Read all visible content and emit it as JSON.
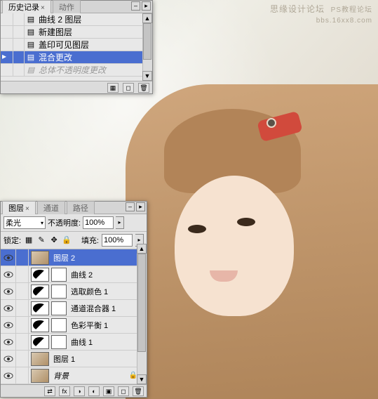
{
  "watermark": {
    "line1": "思缘设计论坛",
    "line2": "PS教程论坛",
    "line3": "bbs.16xx8.com"
  },
  "history_panel": {
    "tabs": {
      "history": "历史记录",
      "actions": "动作"
    },
    "items": [
      {
        "icon": "curves-icon",
        "label": "曲线 2 图层"
      },
      {
        "icon": "new-layer-icon",
        "label": "新建图层"
      },
      {
        "icon": "stamp-icon",
        "label": "盖印可见图层"
      },
      {
        "icon": "blend-icon",
        "label": "混合更改",
        "selected": true
      },
      {
        "icon": "opacity-icon",
        "label": "总体不透明度更改",
        "disabled": true
      }
    ]
  },
  "layers_panel": {
    "tabs": {
      "layers": "图层",
      "channels": "通道",
      "paths": "路径"
    },
    "blend_label": "柔光",
    "opacity_label": "不透明度:",
    "opacity_value": "100%",
    "lock_label": "锁定:",
    "fill_label": "填充:",
    "fill_value": "100%",
    "layers": [
      {
        "name": "图层 2",
        "type": "img",
        "selected": true
      },
      {
        "name": "曲线 2",
        "type": "adj"
      },
      {
        "name": "选取颜色 1",
        "type": "adj"
      },
      {
        "name": "通道混合器 1",
        "type": "adj"
      },
      {
        "name": "色彩平衡 1",
        "type": "adj"
      },
      {
        "name": "曲线 1",
        "type": "adj"
      },
      {
        "name": "图层 1",
        "type": "img"
      },
      {
        "name": "背景",
        "type": "img",
        "locked": true,
        "bg": true
      }
    ]
  }
}
